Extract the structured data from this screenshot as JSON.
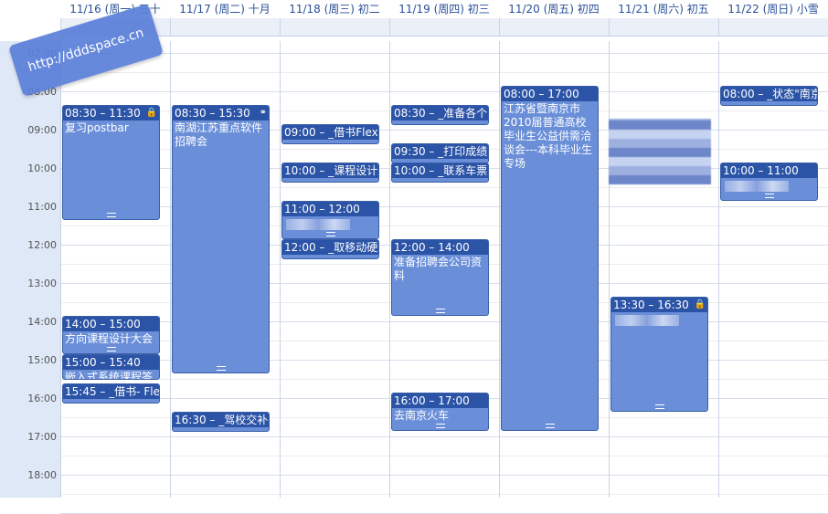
{
  "days": [
    {
      "label": "11/16 (周一) 三十"
    },
    {
      "label": "11/17 (周二) 十月"
    },
    {
      "label": "11/18 (周三) 初二"
    },
    {
      "label": "11/19 (周四) 初三"
    },
    {
      "label": "11/20 (周五) 初四"
    },
    {
      "label": "11/21 (周六) 初五"
    },
    {
      "label": "11/22 (周日) 小雪"
    }
  ],
  "hours": [
    "07:00",
    "08:00",
    "09:00",
    "10:00",
    "11:00",
    "12:00",
    "13:00",
    "14:00",
    "15:00",
    "16:00",
    "17:00",
    "18:00"
  ],
  "watermark": "http://dddspace.cn",
  "events": [
    {
      "day": 0,
      "start": 8.5,
      "end": 11.5,
      "time": "08:30 – 11:30",
      "title": "复习postbar",
      "locked": true
    },
    {
      "day": 0,
      "start": 14,
      "end": 15,
      "time": "14:00 – 15:00",
      "title": "方向课程设计大会"
    },
    {
      "day": 0,
      "start": 15,
      "end": 15.666,
      "time": "15:00 – 15:40",
      "title": "嵌入式系统课程答"
    },
    {
      "day": 0,
      "start": 15.75,
      "end": 16.25,
      "time": "15:45 – _借书- Fle",
      "title": ""
    },
    {
      "day": 1,
      "start": 8.5,
      "end": 15.5,
      "time": "08:30 – 15:30",
      "title": "南湖江苏重点软件招聘会",
      "linked": true
    },
    {
      "day": 1,
      "start": 16.5,
      "end": 16.9,
      "time": "16:30 – _驾校交补",
      "title": ""
    },
    {
      "day": 2,
      "start": 9,
      "end": 9.5,
      "time": "09:00 – _借书Flex",
      "title": ""
    },
    {
      "day": 2,
      "start": 10,
      "end": 10.5,
      "time": "10:00 – _课程设计决",
      "title": ""
    },
    {
      "day": 2,
      "start": 11,
      "end": 12,
      "time": "11:00 – 12:00",
      "title": "",
      "blurred": true
    },
    {
      "day": 2,
      "start": 12,
      "end": 12.5,
      "time": "12:00 – _取移动硬盘",
      "title": ""
    },
    {
      "day": 3,
      "start": 8.5,
      "end": 9,
      "time": "08:30 – _准备各个",
      "title": ""
    },
    {
      "day": 3,
      "start": 9.5,
      "end": 10,
      "time": "09:30 – _打印成绩",
      "title": ""
    },
    {
      "day": 3,
      "start": 10,
      "end": 10.5,
      "time": "10:00 – _联系车票",
      "title": ""
    },
    {
      "day": 3,
      "start": 12,
      "end": 14,
      "time": "12:00 – 14:00",
      "title": "准备招聘会公司资料"
    },
    {
      "day": 3,
      "start": 16,
      "end": 17,
      "time": "16:00 – 17:00",
      "title": "去南京火车"
    },
    {
      "day": 4,
      "start": 8,
      "end": 17,
      "time": "08:00 – 17:00",
      "title": "江苏省暨南京市2010届普通高校毕业生公益供需洽谈会---本科毕业生专场"
    },
    {
      "day": 5,
      "start": 13.5,
      "end": 16.5,
      "time": "13:30 – 16:30",
      "title": "",
      "locked": true,
      "blurred": true
    },
    {
      "day": 6,
      "start": 8,
      "end": 8.5,
      "time": "08:00 – _状态\"南京",
      "title": ""
    },
    {
      "day": 6,
      "start": 10,
      "end": 11,
      "time": "10:00 – 11:00",
      "title": "",
      "blurred": true
    }
  ]
}
